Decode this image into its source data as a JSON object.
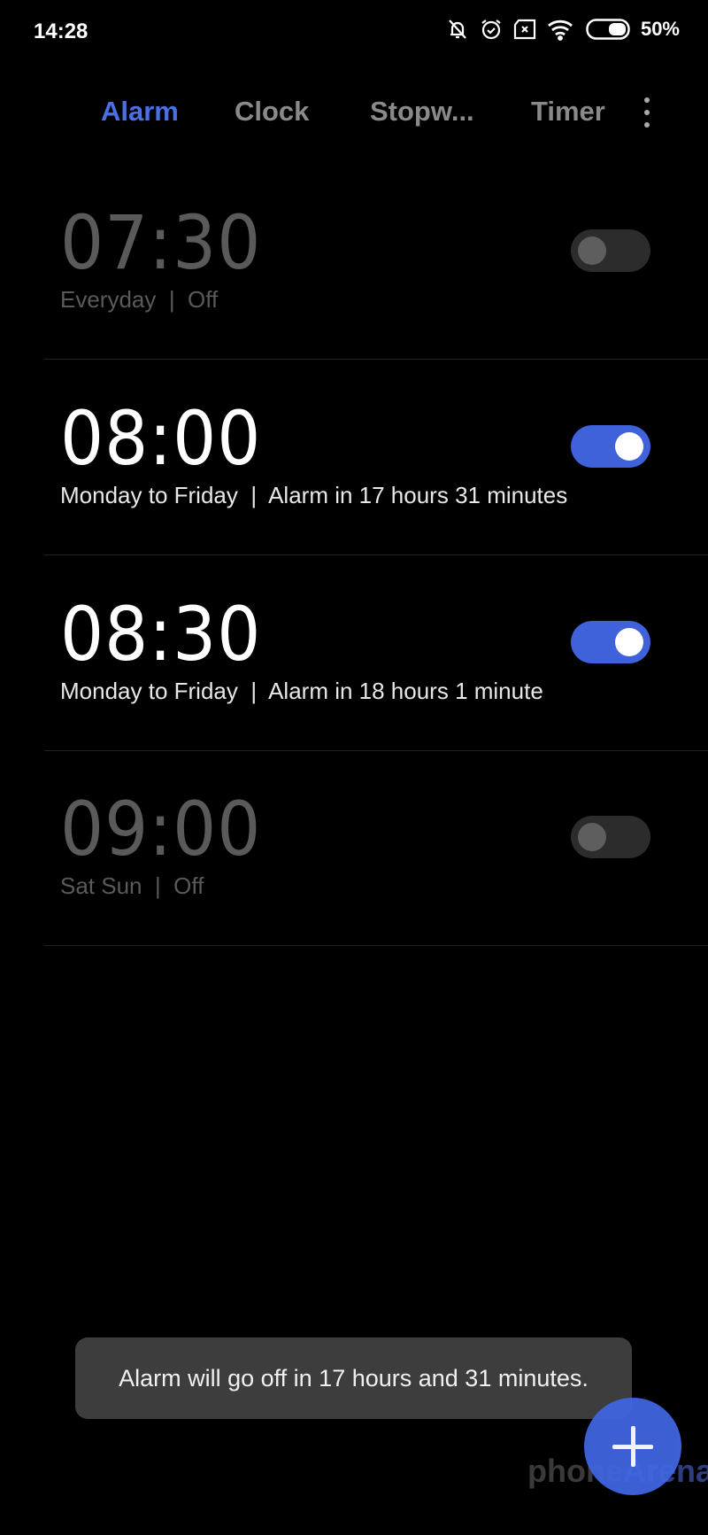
{
  "status": {
    "time": "14:28",
    "battery": "50%",
    "icons": [
      "bell-muted-icon",
      "alarm-icon",
      "sim-off-icon",
      "wifi-icon",
      "battery-icon"
    ]
  },
  "tabs": [
    {
      "label": "Alarm",
      "active": true
    },
    {
      "label": "Clock"
    },
    {
      "label": "Stopw..."
    },
    {
      "label": "Timer"
    }
  ],
  "alarms": [
    {
      "time": "07:30",
      "subtitle": "Everyday  |  Off",
      "enabled": false
    },
    {
      "time": "08:00",
      "subtitle": "Monday to Friday  |  Alarm in 17 hours 31 minutes",
      "enabled": true
    },
    {
      "time": "08:30",
      "subtitle": "Monday to Friday  |  Alarm in 18 hours 1 minute",
      "enabled": true
    },
    {
      "time": "09:00",
      "subtitle": "Sat Sun  |  Off",
      "enabled": false
    }
  ],
  "toast": "Alarm will go off in 17 hours and 31 minutes.",
  "watermark": "phoneArena",
  "colors": {
    "accent": "#4a6fe6",
    "toggle_on": "#3f62db"
  }
}
